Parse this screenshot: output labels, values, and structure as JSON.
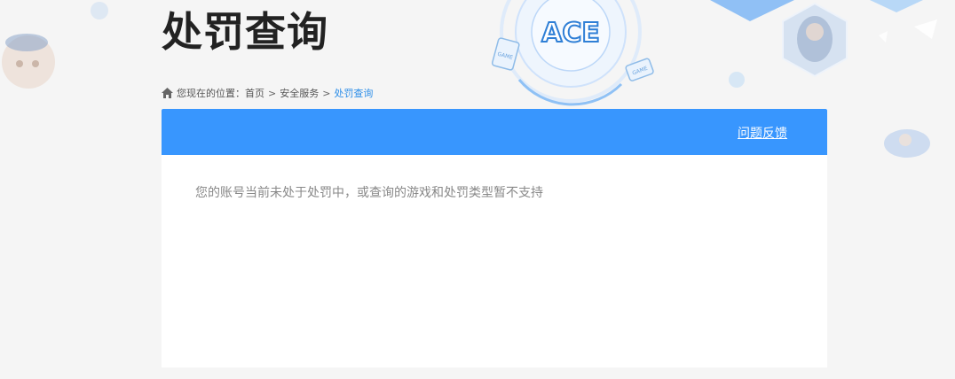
{
  "page": {
    "title": "处罚查询"
  },
  "breadcrumb": {
    "prefix": "您现在的位置：",
    "items": [
      {
        "label": "首页"
      },
      {
        "label": "安全服务"
      },
      {
        "label": "处罚查询"
      }
    ],
    "separator": ">"
  },
  "panel": {
    "feedback_link": "问题反馈",
    "message": "您的账号当前未处于处罚中，或查询的游戏和处罚类型暂不支持"
  },
  "logo": {
    "text": "ACE",
    "badge_left": "GAME",
    "badge_right": "GAME"
  },
  "colors": {
    "header_blue": "#3896fe",
    "breadcrumb_current": "#2b8de8",
    "background": "#f5f5f5"
  }
}
